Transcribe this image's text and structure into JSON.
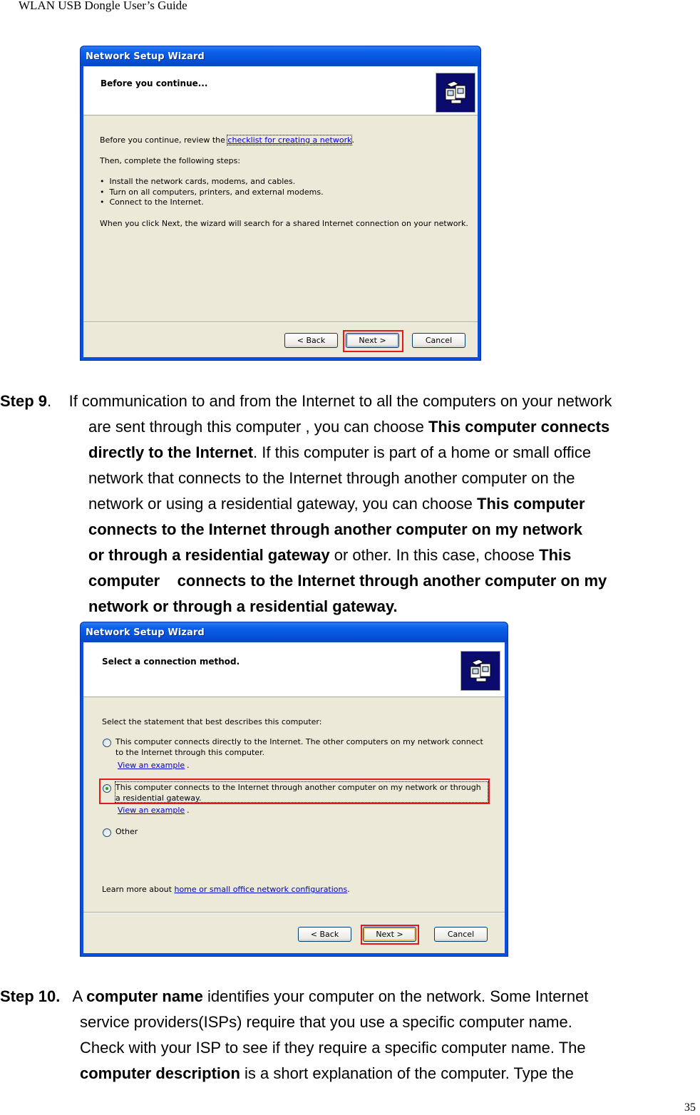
{
  "document": {
    "header": "WLAN USB Dongle User’s Guide",
    "page_number": "35"
  },
  "dialog1": {
    "title": "Network Setup Wizard",
    "heading": "Before you continue...",
    "icon": "network-computers-icon",
    "review_prefix": "Before you continue, review the ",
    "review_link": "checklist for creating a network",
    "review_suffix": ".",
    "steps_intro": "Then, complete the following steps:",
    "bullets": [
      "Install the network cards, modems, and cables.",
      "Turn on all computers, printers, and external modems.",
      "Connect to the Internet."
    ],
    "next_note": "When you click Next, the wizard will search for a shared Internet connection on your network.",
    "buttons": {
      "back": "< Back",
      "next": "Next >",
      "cancel": "Cancel"
    },
    "highlight_color": "#e8161b"
  },
  "step9": {
    "label": "Step 9",
    "lines": [
      [
        {
          "t": ".    If communication to and from the Internet to all the computers on your network",
          "b": false
        }
      ],
      [
        {
          "t": "are sent through this computer , you can choose ",
          "b": false
        },
        {
          "t": "This computer connects",
          "b": true
        }
      ],
      [
        {
          "t": "directly to the Internet",
          "b": true
        },
        {
          "t": ". If this computer is part of a home or small office",
          "b": false
        }
      ],
      [
        {
          "t": "network that connects to the Internet through another computer on the",
          "b": false
        }
      ],
      [
        {
          "t": "network or using a residential gateway, you can choose ",
          "b": false
        },
        {
          "t": "This computer",
          "b": true
        }
      ],
      [
        {
          "t": "connects to the Internet through another computer on my network",
          "b": true
        }
      ],
      [
        {
          "t": "or through a residential gateway",
          "b": true
        },
        {
          "t": " or other. In this case, choose ",
          "b": false
        },
        {
          "t": "This",
          "b": true
        }
      ],
      [
        {
          "t": "computer    connects to the Internet through another computer on my",
          "b": true
        }
      ],
      [
        {
          "t": "network or through a residential gateway.",
          "b": true
        }
      ]
    ]
  },
  "dialog2": {
    "title": "Network Setup Wizard",
    "heading": "Select a connection method.",
    "icon": "network-computers-icon",
    "prompt": "Select the statement that best describes this computer:",
    "options": [
      {
        "line1": "This computer connects directly to the Internet. The other computers on my network connect",
        "line2": "to the Internet through this computer.",
        "example_link": "View an example",
        "checked": false
      },
      {
        "line1": "This computer connects to the Internet through another computer on my network or through",
        "line2": "a residential gateway.",
        "example_link": "View an example",
        "checked": true
      },
      {
        "line1": "Other",
        "checked": false
      }
    ],
    "learn_prefix": "Learn more about ",
    "learn_link": "home or small office network configurations",
    "learn_suffix": ".",
    "buttons": {
      "back": "< Back",
      "next": "Next >",
      "cancel": "Cancel"
    },
    "highlight_color": "#e8161b"
  },
  "step10": {
    "label": "Step 10.",
    "lines": [
      [
        {
          "t": "   A ",
          "b": false
        },
        {
          "t": "computer name",
          "b": true
        },
        {
          "t": " identifies your computer on the network. Some Internet",
          "b": false
        }
      ],
      [
        {
          "t": "service providers(ISPs) require that you use a specific computer name.",
          "b": false
        }
      ],
      [
        {
          "t": "Check with your ISP to see if they require a specific computer name. The",
          "b": false
        }
      ],
      [
        {
          "t": "computer description",
          "b": true
        },
        {
          "t": " is a short explanation of the computer. Type the",
          "b": false
        }
      ]
    ]
  }
}
